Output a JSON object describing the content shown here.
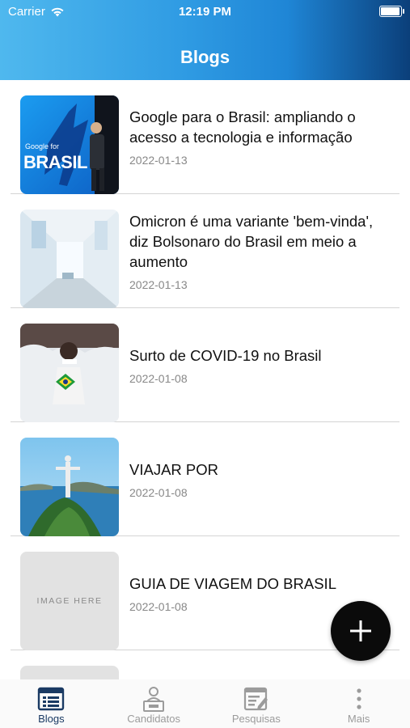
{
  "status": {
    "carrier": "Carrier",
    "time": "12:19 PM",
    "battery_level": 0.95
  },
  "header": {
    "title": "Blogs"
  },
  "posts": [
    {
      "title": "Google para o Brasil: ampliando o acesso a tecnologia e informação",
      "date": "2022-01-13",
      "thumb_text": "BRASIL",
      "thumb_small": "Google for"
    },
    {
      "title": "Omicron é uma variante 'bem-vinda', diz Bolsonaro do Brasil em meio a aumento",
      "date": "2022-01-13"
    },
    {
      "title": "Surto de COVID-19 no Brasil",
      "date": "2022-01-08"
    },
    {
      "title": "VIAJAR POR",
      "date": "2022-01-08"
    },
    {
      "title": "GUIA DE VIAGEM DO BRASIL",
      "date": "2022-01-08",
      "placeholder": "IMAGE HERE"
    }
  ],
  "fab": {
    "label": "+"
  },
  "tabs": [
    {
      "label": "Blogs",
      "icon": "blogs-list-icon",
      "active": true
    },
    {
      "label": "Candidatos",
      "icon": "candidate-podium-icon",
      "active": false
    },
    {
      "label": "Pesquisas",
      "icon": "survey-edit-icon",
      "active": false
    },
    {
      "label": "Mais",
      "icon": "more-vertical-icon",
      "active": false
    }
  ],
  "colors": {
    "header_start": "#4fb8ee",
    "header_end": "#0b3f7a",
    "tab_active": "#1a3a63",
    "tab_inactive": "#9b9b9b",
    "fab": "#0b0b0b"
  }
}
